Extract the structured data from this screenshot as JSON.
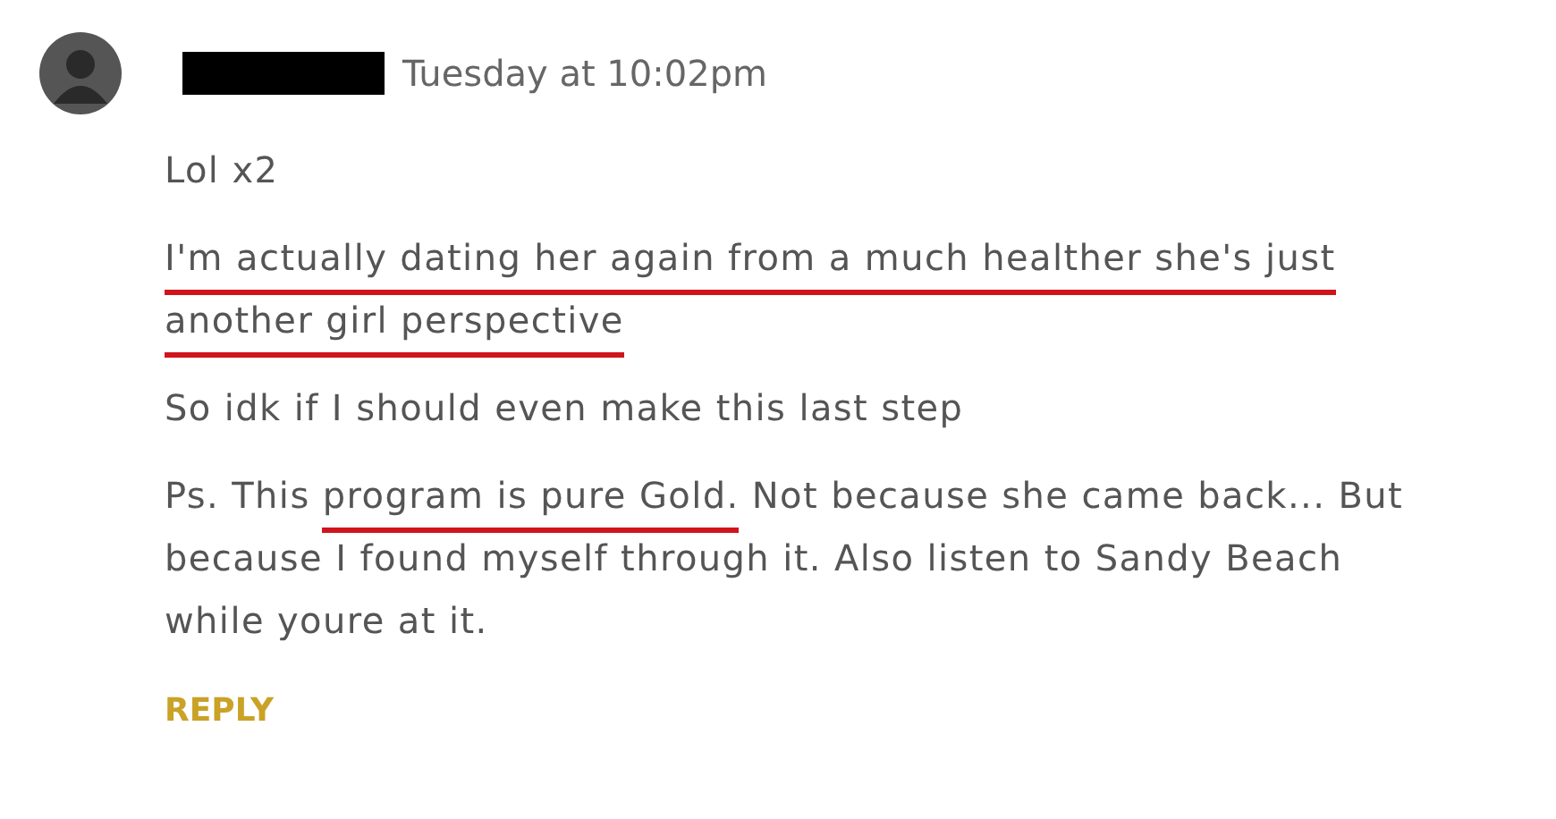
{
  "comment": {
    "author": {
      "redacted": true
    },
    "time": "Tuesday at 10:02pm",
    "paragraphs": [
      {
        "segments": [
          {
            "text": "Lol x2",
            "underlined": false
          }
        ]
      },
      {
        "segments": [
          {
            "text": "I'm actually dating her again from a much healther she's just another girl perspective",
            "underlined": true
          }
        ]
      },
      {
        "segments": [
          {
            "text": "So idk if I should even make this last step",
            "underlined": false
          }
        ]
      },
      {
        "segments": [
          {
            "text": "Ps. This ",
            "underlined": false
          },
          {
            "text": "program is pure Gold.",
            "underlined": true
          },
          {
            "text": " Not because she came back... But because I found myself through it. Also listen to Sandy Beach while youre at it.",
            "underlined": false
          }
        ]
      }
    ],
    "reply": "REPLY"
  }
}
